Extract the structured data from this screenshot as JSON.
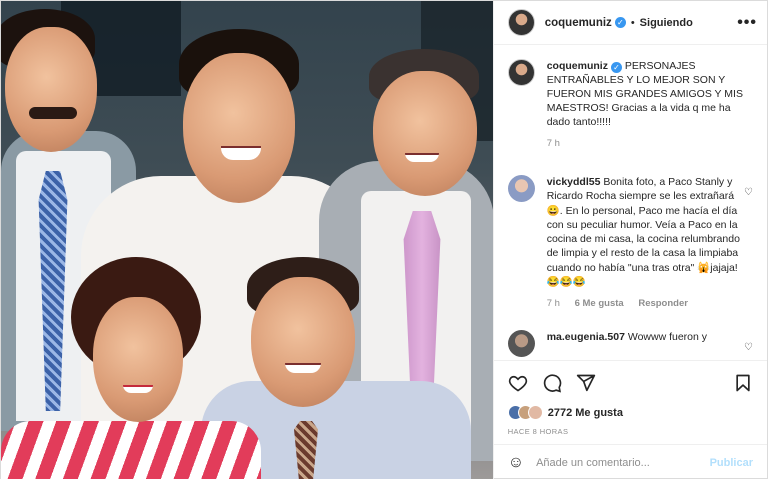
{
  "post": {
    "username": "coquemuniz",
    "follow_status": "Siguiendo",
    "separator": "•",
    "verified_glyph": "✓",
    "more_glyph": "•••",
    "caption_username": "coquemuniz",
    "caption_text": "PERSONAJES ENTRAÑABLES Y LO MEJOR SON Y FUERON MIS GRANDES AMIGOS Y MIS MAESTROS! Gracias a la vida q me ha dado tanto!!!!!",
    "caption_time": "7 h"
  },
  "comments": [
    {
      "username": "vickyddl55",
      "text": "Bonita foto, a Paco Stanly y Ricardo Rocha siempre se les extrañará😀. En lo personal, Paco me hacía el día con su peculiar humor. Veía a Paco en la cocina de mi casa, la cocina relumbrando de limpia y el resto de la casa la limpiaba cuando no había \"una tras otra\" 🙀jajaja! 😂😂😂",
      "time": "7 h",
      "likes": "6 Me gusta",
      "reply": "Responder",
      "heart": "♡"
    },
    {
      "username": "ma.eugenia.507",
      "text": "Wowww fueron y",
      "heart": "♡"
    }
  ],
  "actions": {
    "like_icon": "heart-outline-icon",
    "comment_icon": "comment-icon",
    "share_icon": "share-icon",
    "save_icon": "bookmark-icon",
    "likes_count": "2772",
    "likes_label": "Me gusta",
    "time_ago": "HACE 8 HORAS"
  },
  "comment_box": {
    "emoji": "☺",
    "placeholder": "Añade un comentario...",
    "publish": "Publicar"
  },
  "colors": {
    "accent": "#3897f0",
    "publish_disabled": "#b2dffc",
    "muted": "#8e8e8e",
    "border": "#efefef"
  }
}
